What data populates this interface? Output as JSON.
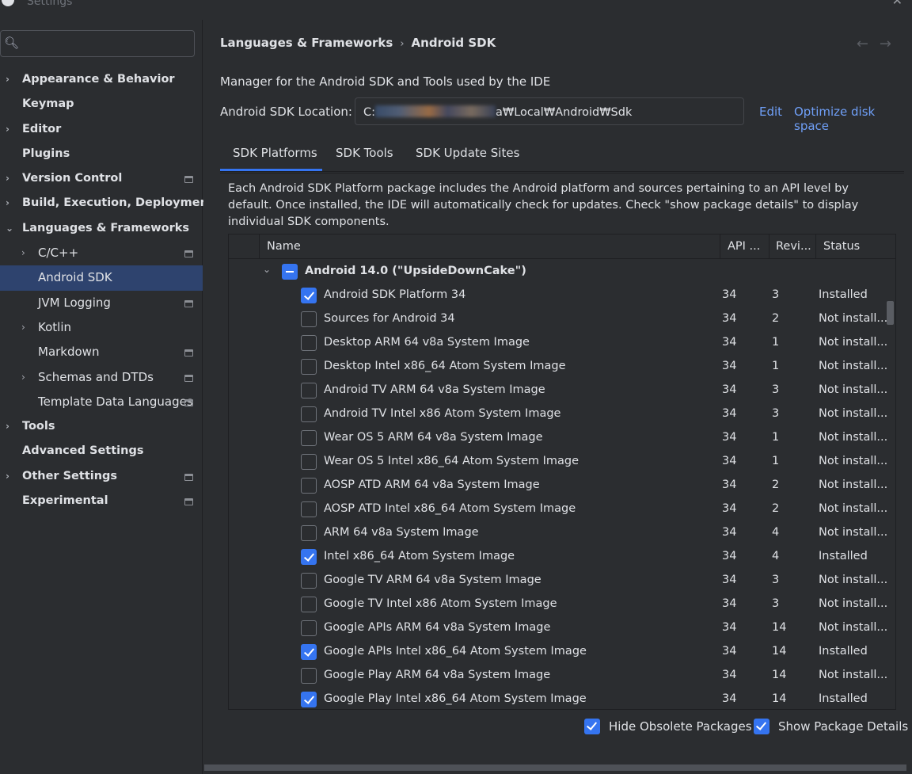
{
  "window": {
    "title": "Settings"
  },
  "sidebar": {
    "search": {
      "placeholder": ""
    },
    "items": [
      {
        "label": "Appearance & Behavior",
        "level": 0,
        "arrow": ">",
        "proj": false,
        "bold": true
      },
      {
        "label": "Keymap",
        "level": 0,
        "arrow": "",
        "proj": false,
        "bold": true
      },
      {
        "label": "Editor",
        "level": 0,
        "arrow": ">",
        "proj": false,
        "bold": true
      },
      {
        "label": "Plugins",
        "level": 0,
        "arrow": "",
        "proj": false,
        "bold": true
      },
      {
        "label": "Version Control",
        "level": 0,
        "arrow": ">",
        "proj": true,
        "bold": true
      },
      {
        "label": "Build, Execution, Deployment",
        "level": 0,
        "arrow": ">",
        "proj": false,
        "bold": true
      },
      {
        "label": "Languages & Frameworks",
        "level": 0,
        "arrow": "v",
        "proj": false,
        "bold": true
      },
      {
        "label": "C/C++",
        "level": 1,
        "arrow": ">",
        "proj": true,
        "bold": false
      },
      {
        "label": "Android SDK",
        "level": 1,
        "arrow": "",
        "proj": false,
        "bold": false,
        "selected": true
      },
      {
        "label": "JVM Logging",
        "level": 1,
        "arrow": "",
        "proj": true,
        "bold": false
      },
      {
        "label": "Kotlin",
        "level": 1,
        "arrow": ">",
        "proj": false,
        "bold": false
      },
      {
        "label": "Markdown",
        "level": 1,
        "arrow": "",
        "proj": true,
        "bold": false
      },
      {
        "label": "Schemas and DTDs",
        "level": 1,
        "arrow": ">",
        "proj": true,
        "bold": false
      },
      {
        "label": "Template Data Languages",
        "level": 1,
        "arrow": "",
        "proj": true,
        "bold": false
      },
      {
        "label": "Tools",
        "level": 0,
        "arrow": ">",
        "proj": false,
        "bold": true
      },
      {
        "label": "Advanced Settings",
        "level": 0,
        "arrow": "",
        "proj": false,
        "bold": true
      },
      {
        "label": "Other Settings",
        "level": 0,
        "arrow": ">",
        "proj": true,
        "bold": true
      },
      {
        "label": "Experimental",
        "level": 0,
        "arrow": "",
        "proj": true,
        "bold": true
      }
    ]
  },
  "header": {
    "breadcrumb_parent": "Languages & Frameworks",
    "breadcrumb_sep": "›",
    "breadcrumb_current": "Android SDK",
    "back_arrow": "←",
    "forward_arrow": "→"
  },
  "main": {
    "description": "Manager for the Android SDK and Tools used by the IDE",
    "location_label": "Android SDK Location:",
    "location_prefix": "C:",
    "location_suffix": "a₩Local₩Android₩Sdk",
    "edit_link": "Edit",
    "optimize_link": "Optimize disk space",
    "tabs": [
      "SDK Platforms",
      "SDK Tools",
      "SDK Update Sites"
    ],
    "info_text": "Each Android SDK Platform package includes the Android platform and sources pertaining to an API level by default. Once installed, the IDE will automatically check for updates. Check \"show package details\" to display individual SDK components."
  },
  "table": {
    "columns": {
      "name": "Name",
      "api": "API ...",
      "rev": "Revi...",
      "status": "Status"
    },
    "group": {
      "name": "Android 14.0 (\"UpsideDownCake\")",
      "chevron": "v"
    },
    "rows": [
      {
        "name": "Android SDK Platform 34",
        "api": "34",
        "rev": "3",
        "status": "Installed",
        "checked": true
      },
      {
        "name": "Sources for Android 34",
        "api": "34",
        "rev": "2",
        "status": "Not install...",
        "checked": false
      },
      {
        "name": "Desktop ARM 64 v8a System Image",
        "api": "34",
        "rev": "1",
        "status": "Not install...",
        "checked": false
      },
      {
        "name": "Desktop Intel x86_64 Atom System Image",
        "api": "34",
        "rev": "1",
        "status": "Not install...",
        "checked": false
      },
      {
        "name": "Android TV ARM 64 v8a System Image",
        "api": "34",
        "rev": "3",
        "status": "Not install...",
        "checked": false
      },
      {
        "name": "Android TV Intel x86 Atom System Image",
        "api": "34",
        "rev": "3",
        "status": "Not install...",
        "checked": false
      },
      {
        "name": "Wear OS 5 ARM 64 v8a System Image",
        "api": "34",
        "rev": "1",
        "status": "Not install...",
        "checked": false
      },
      {
        "name": "Wear OS 5 Intel x86_64 Atom System Image",
        "api": "34",
        "rev": "1",
        "status": "Not install...",
        "checked": false
      },
      {
        "name": "AOSP ATD ARM 64 v8a System Image",
        "api": "34",
        "rev": "2",
        "status": "Not install...",
        "checked": false
      },
      {
        "name": "AOSP ATD Intel x86_64 Atom System Image",
        "api": "34",
        "rev": "2",
        "status": "Not install...",
        "checked": false
      },
      {
        "name": "ARM 64 v8a System Image",
        "api": "34",
        "rev": "4",
        "status": "Not install...",
        "checked": false
      },
      {
        "name": "Intel x86_64 Atom System Image",
        "api": "34",
        "rev": "4",
        "status": "Installed",
        "checked": true
      },
      {
        "name": "Google TV ARM 64 v8a System Image",
        "api": "34",
        "rev": "3",
        "status": "Not install...",
        "checked": false
      },
      {
        "name": "Google TV Intel x86 Atom System Image",
        "api": "34",
        "rev": "3",
        "status": "Not install...",
        "checked": false
      },
      {
        "name": "Google APIs ARM 64 v8a System Image",
        "api": "34",
        "rev": "14",
        "status": "Not install...",
        "checked": false
      },
      {
        "name": "Google APIs Intel x86_64 Atom System Image",
        "api": "34",
        "rev": "14",
        "status": "Installed",
        "checked": true
      },
      {
        "name": "Google Play ARM 64 v8a System Image",
        "api": "34",
        "rev": "14",
        "status": "Not install...",
        "checked": false
      },
      {
        "name": "Google Play Intel x86_64 Atom System Image",
        "api": "34",
        "rev": "14",
        "status": "Installed",
        "checked": true
      }
    ]
  },
  "options": {
    "hide_obsolete": "Hide Obsolete Packages",
    "show_details": "Show Package Details"
  },
  "colors": {
    "accent": "#3574f0",
    "link": "#6f9ff7",
    "selection": "#2e436e",
    "background": "#2b2d30"
  }
}
